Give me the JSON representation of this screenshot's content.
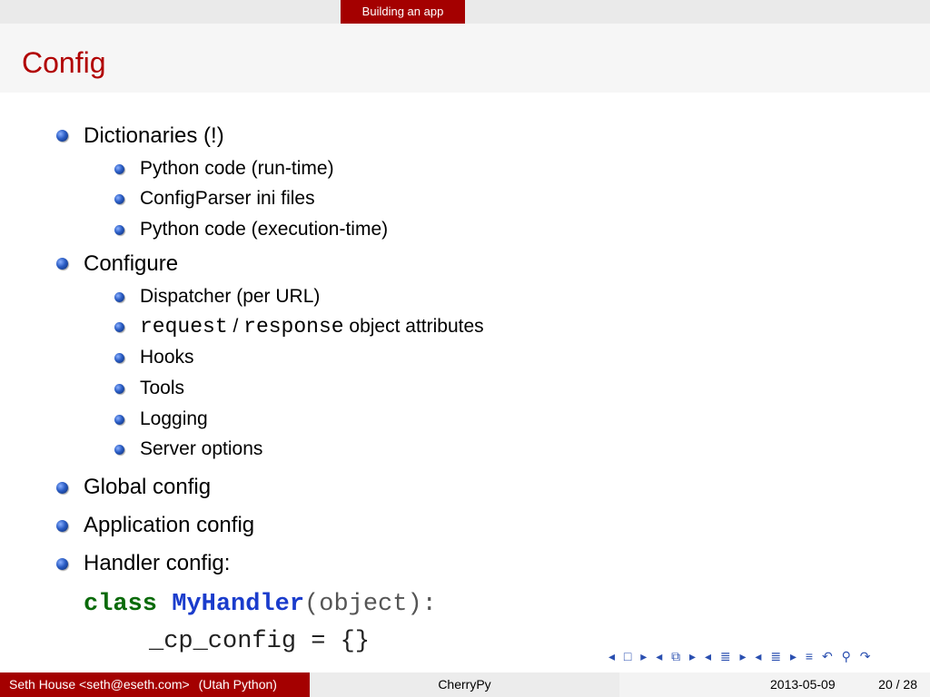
{
  "header": {
    "section": "Building an app"
  },
  "frame": {
    "title": "Config"
  },
  "bullets": [
    {
      "text": "Dictionaries (!)",
      "children": [
        "Python code (run-time)",
        "ConfigParser ini files",
        "Python code (execution-time)"
      ]
    },
    {
      "text": "Configure",
      "children": [
        "Dispatcher (per URL)",
        {
          "code1": "request",
          "sep": " / ",
          "code2": "response",
          "rest": " object attributes"
        },
        "Hooks",
        "Tools",
        "Logging",
        "Server options"
      ]
    },
    {
      "text": "Global config"
    },
    {
      "text": "Application config"
    },
    {
      "text": "Handler config:"
    }
  ],
  "code": {
    "line1_kw": "class",
    "line1_name": "MyHandler",
    "line1_rest": "(object):",
    "line2": "_cp_config = {}"
  },
  "navigation_icons": [
    "nav-left-icon",
    "nav-frame-icon",
    "nav-right-icon",
    "nav-subsection-icon",
    "nav-section-icon",
    "nav-align-icon",
    "nav-undo-icon",
    "nav-search-icon",
    "nav-redo-icon"
  ],
  "footer": {
    "author": "Seth House <seth@eseth.com>",
    "institute": "(Utah Python)",
    "title": "CherryPy",
    "date": "2013-05-09",
    "page": "20 / 28"
  },
  "colors": {
    "accent": "#a40000",
    "title": "#b10000",
    "bullet": "#2a5cc4"
  }
}
